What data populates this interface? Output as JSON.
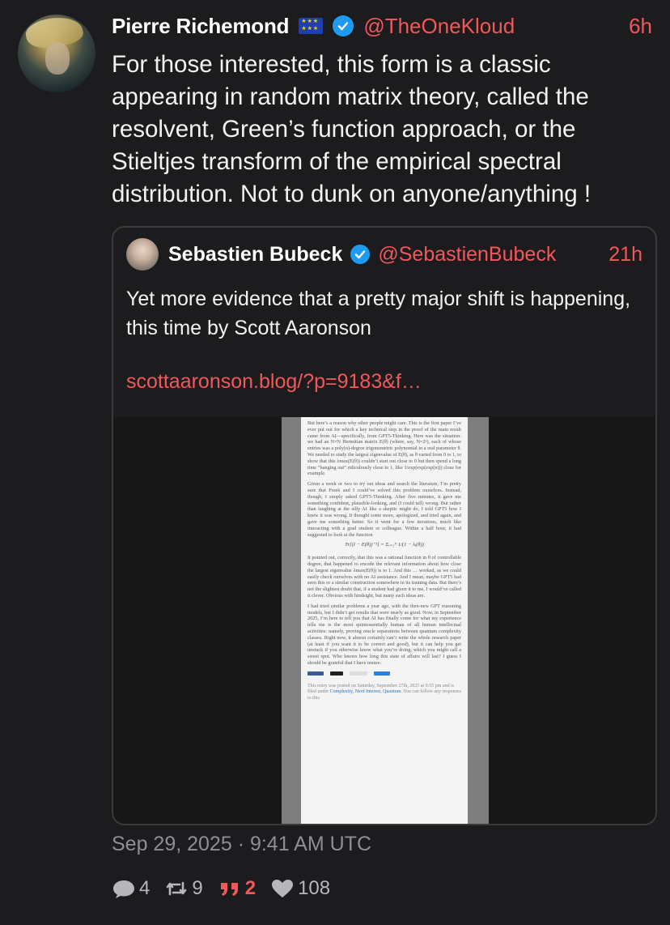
{
  "tweet": {
    "author_name": "Pierre Richemond",
    "handle": "@TheOneKloud",
    "time": "6h",
    "text": "For those interested, this form is a classic appearing in random matrix theory, called the resolvent, Green’s function approach, or the Stieltjes transform of the empirical spectral distribution. Not to dunk on anyone/anything !",
    "date": "Sep 29, 2025 · 9:41 AM UTC"
  },
  "quoted": {
    "author_name": "Sebastien Bubeck",
    "handle": "@SebastienBubeck",
    "time": "21h",
    "text": "Yet more evidence that a pretty major shift is happening, this time by Scott Aaronson",
    "link": "scottaaronson.blog/?p=9183&f…"
  },
  "document": {
    "paragraphs": [
      "But here’s a reason why other people might care. This is the first paper I’ve ever put out for which a key technical step in the proof of the main result came from AI—specifically, from GPT5-Thinking. Here was the situation: we had an N×N Hermitian matrix E(θ) (where, say, N=2ⁿ), each of whose entries was a poly(n)-degree trigonometric polynomial in a real parameter θ. We needed to study the largest eigenvalue of E(θ), as θ varied from 0 to 1, to show that this λmax(E(θ)) couldn’t start out close to 0 but then spend a long time “hanging out” ridiculously close to 1, like 1/exp(exp(exp(n))) close for example.",
      "Given a week or two to try out ideas and search the literature, I’m pretty sure that Freek and I could’ve solved this problem ourselves. Instead, though, I simply asked GPT5-Thinking. After five minutes, it gave me something confident, plausible-looking, and (I could tell) wrong. But rather than laughing at the silly AI like a skeptic might do, I told GPT5 how I knew it was wrong. It thought some more, apologized, and tried again, and gave me something better. So it went for a few iterations, much like interacting with a grad student or colleague. Within a half hour, it had suggested to look at the function",
      "It pointed out, correctly, that this was a rational function in θ of controllable degree, that happened to encode the relevant information about how close the largest eigenvalue λmax(E(θ)) is to 1. And this … worked, as we could easily check ourselves with no AI assistance. And I mean, maybe GPT5 had seen this or a similar construction somewhere in its training data. But there’s not the slightest doubt that, if a student had given it to me, I would’ve called it clever. Obvious with hindsight, but many such ideas are.",
      "I had tried similar problems a year ago, with the then-new GPT reasoning models, but I didn’t get results that were nearly as good. Now, in September 2025, I’m here to tell you that AI has finally come for what my experience tells me is the most quintessentially human of all human intellectual activities: namely, proving oracle separations between quantum complexity classes. Right now, it almost certainly can’t write the whole research paper (at least if you want it to be correct and good), but it can help you get unstuck if you otherwise know what you’re doing, which you might call a sweet spot. Who knows how long this state of affairs will last? I guess I should be grateful that I have tenure."
    ],
    "formula": "Tr[(I − E(θ))⁻¹] = Σᵢ₌₁ᴺ 1/(1 − λᵢ(θ))",
    "footer_prefix": "This entry was posted on Saturday, September 27th, 2025 at 6:55 pm and is filed under ",
    "footer_links": "Complexity, Nerd Interest, Quantum",
    "footer_suffix": ". You can follow any responses to this"
  },
  "actions": {
    "replies": "4",
    "retweets": "9",
    "quotes": "2",
    "likes": "108"
  },
  "colors": {
    "accent": "#f2575a",
    "verified": "#1d9bf0",
    "background": "#1c1c1e"
  }
}
